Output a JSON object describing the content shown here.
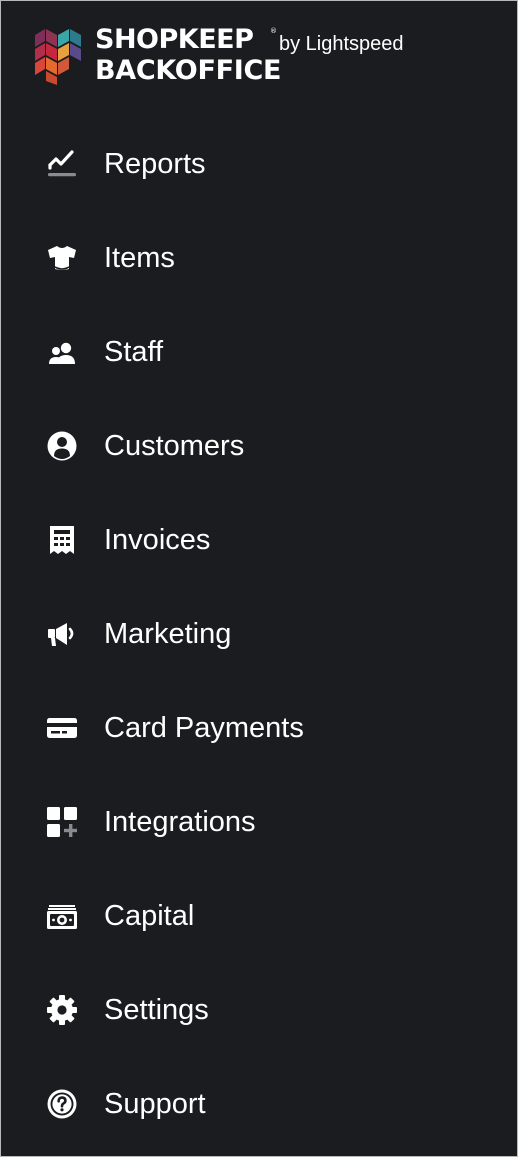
{
  "brand": {
    "line1": "SHOPKEEP",
    "registered": "®",
    "by_line": "by Lightspeed",
    "line2": "BACKOFFICE"
  },
  "nav": {
    "items": [
      {
        "label": "Reports",
        "icon": "reports-chart-icon"
      },
      {
        "label": "Items",
        "icon": "tshirt-icon"
      },
      {
        "label": "Staff",
        "icon": "users-icon"
      },
      {
        "label": "Customers",
        "icon": "user-circle-icon"
      },
      {
        "label": "Invoices",
        "icon": "receipt-icon"
      },
      {
        "label": "Marketing",
        "icon": "megaphone-icon"
      },
      {
        "label": "Card Payments",
        "icon": "credit-card-icon"
      },
      {
        "label": "Integrations",
        "icon": "grid-plus-icon"
      },
      {
        "label": "Capital",
        "icon": "money-bill-icon"
      },
      {
        "label": "Settings",
        "icon": "gear-icon"
      },
      {
        "label": "Support",
        "icon": "question-circle-icon"
      }
    ]
  },
  "colors": {
    "sidebar_background": "#1b1c20",
    "text": "#ffffff",
    "border": "#b7b8bb",
    "logo_segments": [
      "#8e3351",
      "#c5283d",
      "#e46b2b",
      "#3aa6a8",
      "#2c7a8c",
      "#e8a03c",
      "#5a4a8a"
    ]
  }
}
